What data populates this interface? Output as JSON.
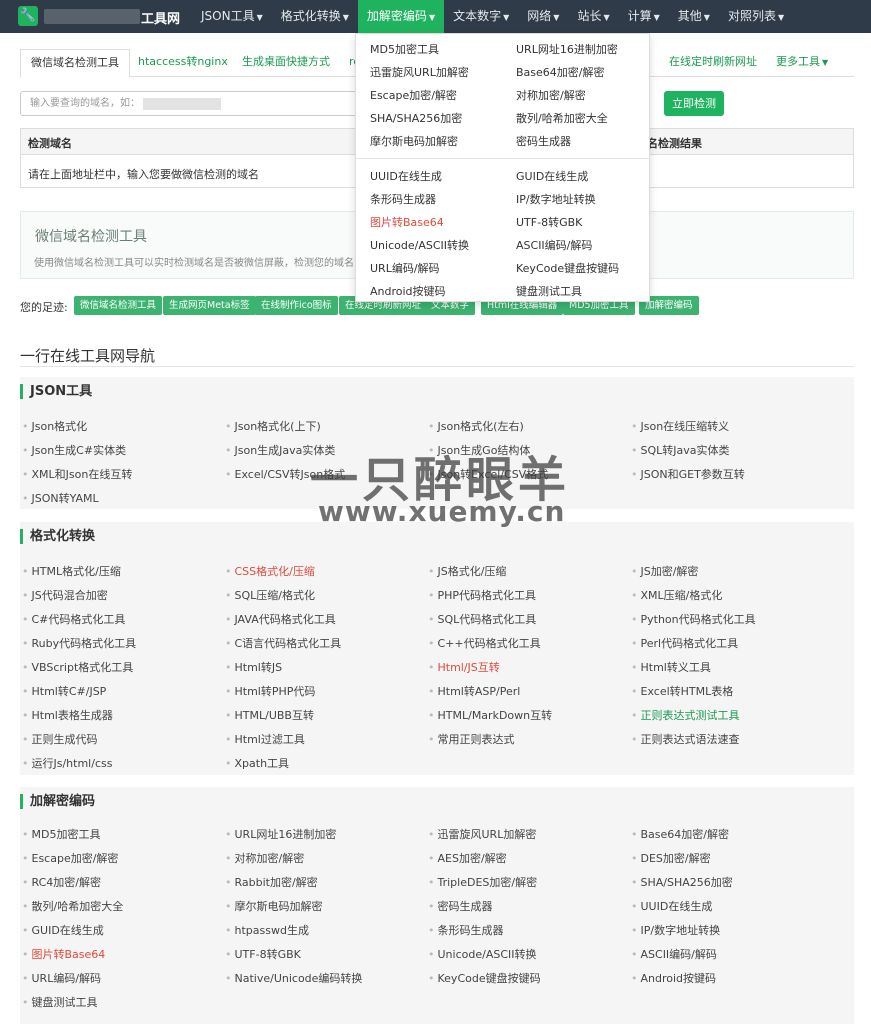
{
  "header": {
    "logo_icon": "wrench-icon",
    "brand": "工具网",
    "nav": [
      {
        "label": "JSON工具"
      },
      {
        "label": "格式化转换"
      },
      {
        "label": "加解密编码"
      },
      {
        "label": "文本数字"
      },
      {
        "label": "网络"
      },
      {
        "label": "站长"
      },
      {
        "label": "计算"
      },
      {
        "label": "其他"
      },
      {
        "label": "对照列表"
      }
    ],
    "accent_color": "#1fb35f"
  },
  "tabs": {
    "t0": "微信域名检测工具",
    "t1": "htaccess转nginx",
    "t2": "生成桌面快捷方式",
    "t3": "re",
    "t4": "在线定时刷新网址",
    "t5": "更多工具"
  },
  "search": {
    "placeholder": "输入要查询的域名，如：",
    "button": "立即检测"
  },
  "result_table": {
    "col1": "检测域名",
    "col2": "名检测结果",
    "row_text": "请在上面地址栏中，输入您要做微信检测的域名"
  },
  "info": {
    "title": "微信域名检测工具",
    "desc": "使用微信域名检测工具可以实时检测域名是否被微信屏蔽，检测您的域名"
  },
  "footprint": {
    "label": "您的足迹:",
    "items": [
      "微信域名检测工具",
      "生成网页Meta标签",
      "在线制作ico图标",
      "在线定时刷新网址",
      "文本数字",
      "Html在线编辑器",
      "MD5加密工具",
      "加解密编码"
    ]
  },
  "nav_title": "一行在线工具网导航",
  "sections": {
    "json": {
      "title": "JSON工具",
      "items": [
        "Json格式化",
        "Json格式化(上下)",
        "Json格式化(左右)",
        "Json在线压缩转义",
        "Json生成C#实体类",
        "Json生成Java实体类",
        "Json生成Go结构体",
        "SQL转Java实体类",
        "XML和Json在线互转",
        "Excel/CSV转Json格式",
        "Json转Excel/CSV格式",
        "JSON和GET参数互转",
        "JSON转YAML"
      ]
    },
    "format": {
      "title": "格式化转换",
      "items": [
        "HTML格式化/压缩",
        "CSS格式化/压缩",
        "JS格式化/压缩",
        "JS加密/解密",
        "JS代码混合加密",
        "SQL压缩/格式化",
        "PHP代码格式化工具",
        "XML压缩/格式化",
        "C#代码格式化工具",
        "JAVA代码格式化工具",
        "SQL代码格式化工具",
        "Python代码格式化工具",
        "Ruby代码格式化工具",
        "C语言代码格式化工具",
        "C++代码格式化工具",
        "Perl代码格式化工具",
        "VBScript格式化工具",
        "Html转JS",
        "Html/JS互转",
        "Html转义工具",
        "Html转C#/JSP",
        "Html转PHP代码",
        "Html转ASP/Perl",
        "Excel转HTML表格",
        "Html表格生成器",
        "HTML/UBB互转",
        "HTML/MarkDown互转",
        "正则表达式测试工具",
        "正则生成代码",
        "Html过滤工具",
        "常用正则表达式",
        "正则表达式语法速查",
        "运行Js/html/css",
        "Xpath工具"
      ]
    },
    "crypto": {
      "title": "加解密编码",
      "items": [
        "MD5加密工具",
        "URL网址16进制加密",
        "迅雷旋风URL加解密",
        "Base64加密/解密",
        "Escape加密/解密",
        "对称加密/解密",
        "AES加密/解密",
        "DES加密/解密",
        "RC4加密/解密",
        "Rabbit加密/解密",
        "TripleDES加密/解密",
        "SHA/SHA256加密",
        "散列/哈希加密大全",
        "摩尔斯电码加解密",
        "密码生成器",
        "UUID在线生成",
        "GUID在线生成",
        "htpasswd生成",
        "条形码生成器",
        "IP/数字地址转换",
        "图片转Base64",
        "UTF-8转GBK",
        "Unicode/ASCII转换",
        "ASCII编码/解码",
        "URL编码/解码",
        "Native/Unicode编码转换",
        "KeyCode键盘按键码",
        "Android按键码",
        "键盘测试工具"
      ]
    }
  },
  "dropdown": {
    "items": [
      "MD5加密工具",
      "URL网址16进制加密",
      "迅雷旋风URL加解密",
      "Base64加密/解密",
      "Escape加密/解密",
      "对称加密/解密",
      "SHA/SHA256加密",
      "散列/哈希加密大全",
      "摩尔斯电码加解密",
      "密码生成器",
      "UUID在线生成",
      "GUID在线生成",
      "条形码生成器",
      "IP/数字地址转换",
      "图片转Base64",
      "UTF-8转GBK",
      "Unicode/ASCII转换",
      "ASCII编码/解码",
      "URL编码/解码",
      "KeyCode键盘按键码",
      "Android按键码",
      "键盘测试工具"
    ]
  },
  "watermark": {
    "line1": "一只醉眼羊",
    "line2": "www.xuemy.cn"
  }
}
